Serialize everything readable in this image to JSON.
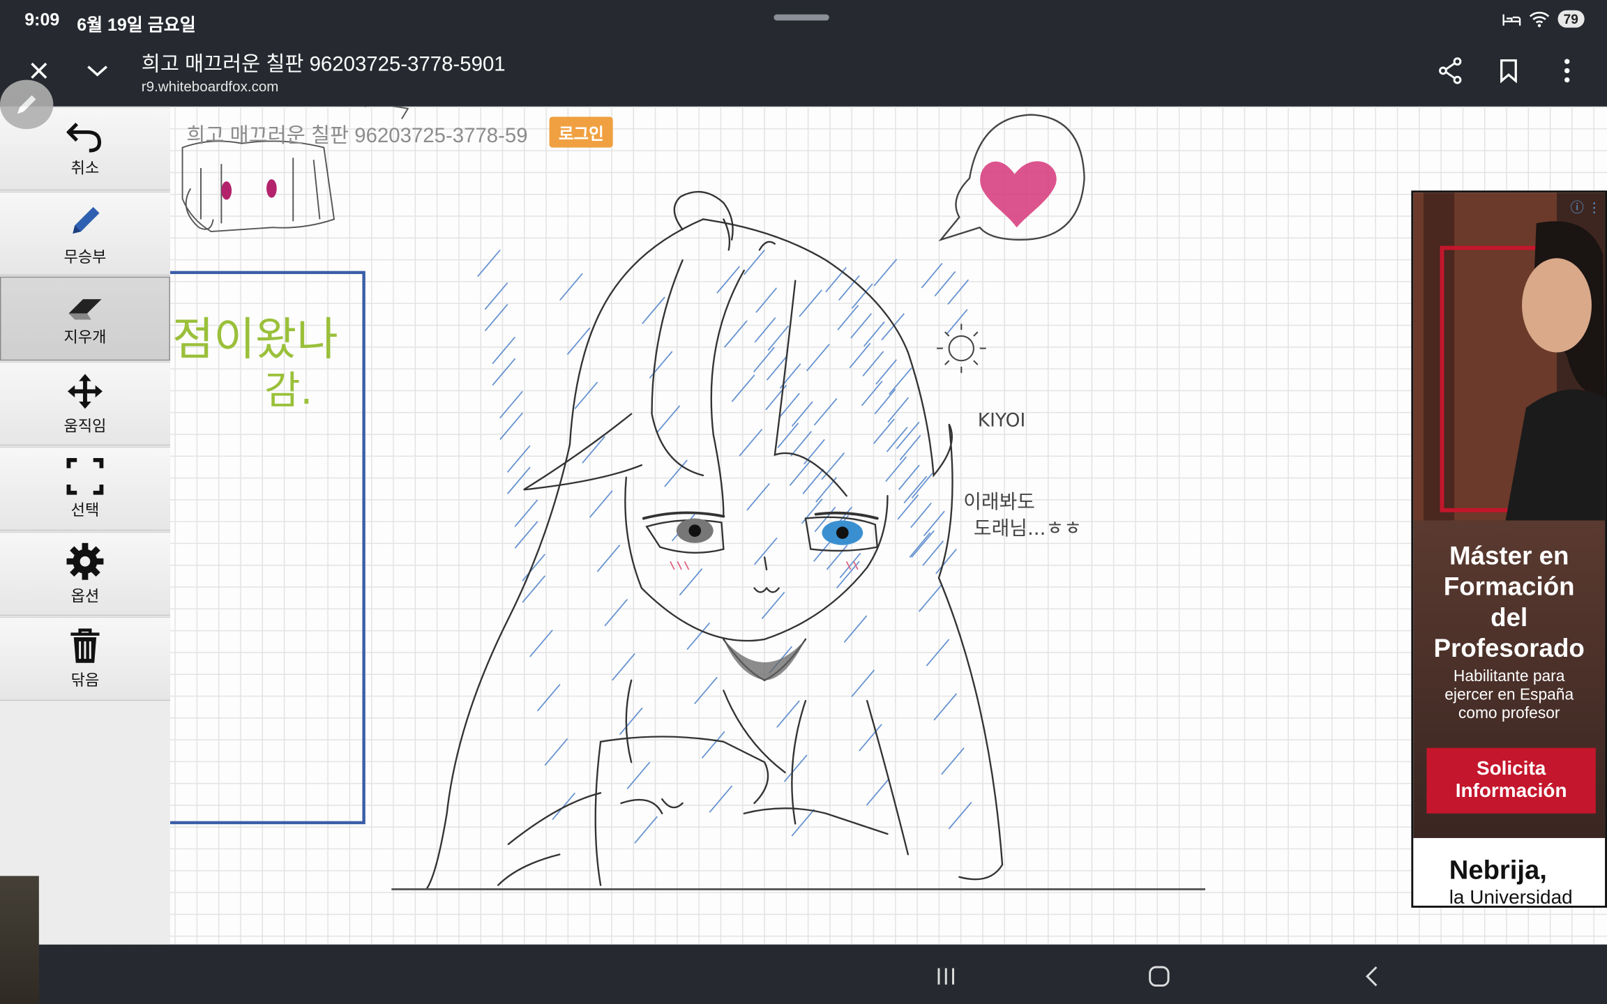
{
  "status": {
    "time": "9:09",
    "date": "6월 19일 금요일",
    "battery": "79"
  },
  "browser": {
    "title": "희고 매끄러운 칠판 96203725-3778-5901",
    "url": "r9.whiteboardfox.com"
  },
  "board": {
    "title": "희고 매끄러운 칠판 96203725-3778-59",
    "login_label": "로그인"
  },
  "toolbar": {
    "tools": [
      {
        "label": "취소",
        "icon": "undo-icon"
      },
      {
        "label": "무승부",
        "icon": "pencil-icon"
      },
      {
        "label": "지우개",
        "icon": "eraser-icon",
        "active": true
      },
      {
        "label": "움직임",
        "icon": "move-icon"
      },
      {
        "label": "선택",
        "icon": "select-icon"
      },
      {
        "label": "옵션",
        "icon": "gear-icon"
      },
      {
        "label": "닦음",
        "icon": "trash-icon"
      }
    ]
  },
  "drawing": {
    "handwriting_green": [
      "점이왔나",
      "감."
    ],
    "signature": "KIYOI",
    "note_lines": [
      "이래봐도",
      "도래님...ㅎㅎ"
    ]
  },
  "ad": {
    "headline": [
      "Máster en",
      "Formación",
      "del",
      "Profesorado"
    ],
    "subtext": [
      "Habilitante para",
      "ejercer en España",
      "como profesor"
    ],
    "cta": [
      "Solicita",
      "Información"
    ],
    "brand_name": "Nebrija,",
    "brand_sub": "la Universidad"
  },
  "colors": {
    "accent_login": "#f0a040",
    "ad_cta": "#c4162c",
    "hatch_blue": "#4a7fc9",
    "heart_pink": "#d6367a",
    "green_text": "#9ac03a"
  }
}
